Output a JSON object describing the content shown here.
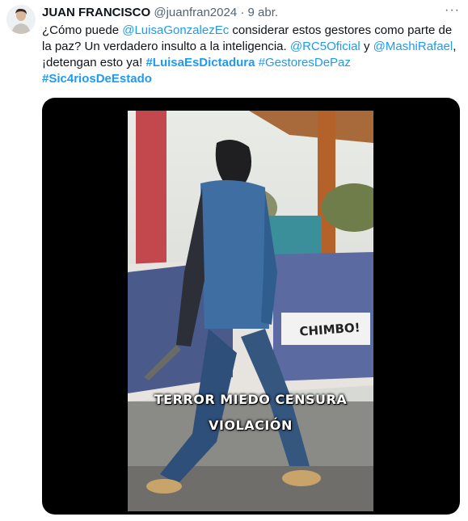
{
  "tweet": {
    "author": {
      "name": "JUAN FRANCISCO",
      "handle": "@juanfran2024",
      "separator": "·",
      "date": "9 abr."
    },
    "more_label": "···",
    "text_parts": [
      {
        "t": "¿Cómo puede ",
        "kind": "text"
      },
      {
        "t": "@LuisaGonzalezEc",
        "kind": "mention"
      },
      {
        "t": " considerar estos gestores como parte de la paz? Un verdadero insulto a la inteligencia. ",
        "kind": "text"
      },
      {
        "t": "@RC5Oficial",
        "kind": "mention"
      },
      {
        "t": " y ",
        "kind": "text"
      },
      {
        "t": "@MashiRafael",
        "kind": "mention"
      },
      {
        "t": ", ¡detengan esto ya! ",
        "kind": "text"
      },
      {
        "t": "#LuisaEsDictadura",
        "kind": "hashtag"
      },
      {
        "t": " ",
        "kind": "text"
      },
      {
        "t": "#GestoresDePaz",
        "kind": "mention"
      },
      {
        "t": " ",
        "kind": "text"
      },
      {
        "t": "#Sic4riosDeEstado",
        "kind": "hashtag"
      }
    ],
    "video": {
      "caption_line1": "TERROR MIEDO CENSURA",
      "caption_line2": "VIOLACIÓN",
      "banner_text": "CHIMBO!"
    }
  },
  "colors": {
    "link": "#1d9bf0",
    "text": "#0f1419",
    "muted": "#536471",
    "media_bg": "#000000"
  }
}
